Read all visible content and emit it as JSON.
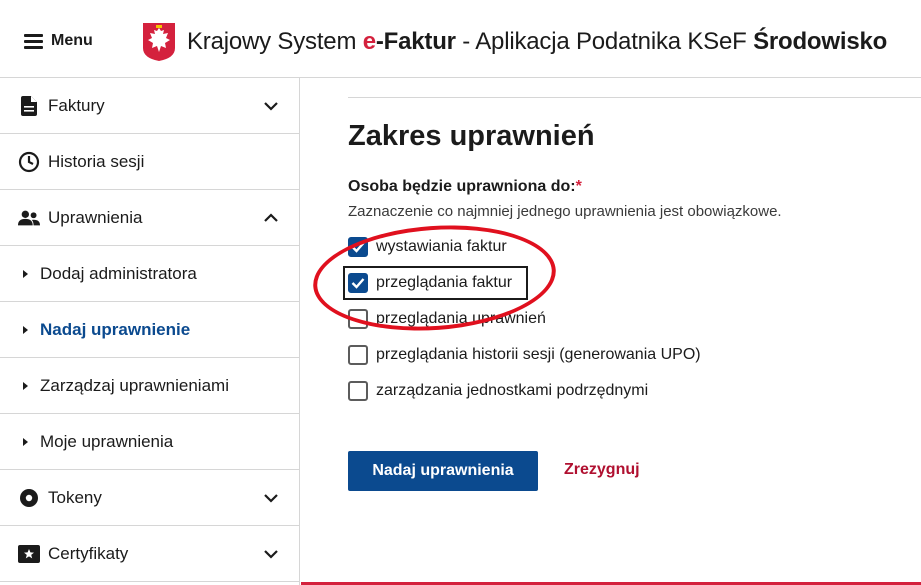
{
  "header": {
    "menu_label": "Menu",
    "title_prefix": "Krajowy System ",
    "title_e": "e",
    "title_faktur": "-Faktur",
    "title_middle": " - Aplikacja Podatnika KSeF ",
    "title_env": "Środowisko"
  },
  "sidebar": {
    "items": [
      {
        "label": "Faktury",
        "icon": "document-icon"
      },
      {
        "label": "Historia sesji",
        "icon": "clock-icon"
      },
      {
        "label": "Uprawnienia",
        "icon": "users-icon"
      },
      {
        "label": "Dodaj administratora"
      },
      {
        "label": "Nadaj uprawnienie"
      },
      {
        "label": "Zarządzaj uprawnieniami"
      },
      {
        "label": "Moje uprawnienia"
      },
      {
        "label": "Tokeny",
        "icon": "token-icon"
      },
      {
        "label": "Certyfikaty",
        "icon": "certificate-icon"
      }
    ]
  },
  "main": {
    "section_title": "Zakres uprawnień",
    "field_label": "Osoba będzie uprawniona do:",
    "required_mark": "*",
    "hint": "Zaznaczenie co najmniej jednego uprawnienia jest obowiązkowe.",
    "options": [
      {
        "label": "wystawiania faktur",
        "checked": true
      },
      {
        "label": "przeglądania faktur",
        "checked": true
      },
      {
        "label": "przeglądania uprawnień",
        "checked": false
      },
      {
        "label": "przeglądania historii sesji (generowania UPO)",
        "checked": false
      },
      {
        "label": "zarządzania jednostkami podrzędnymi",
        "checked": false
      }
    ],
    "submit_label": "Nadaj uprawnienia",
    "cancel_label": "Zrezygnuj"
  },
  "colors": {
    "primary": "#0b4a8f",
    "accent_red": "#d4213d",
    "annotation_red": "#e0101e",
    "cancel_red": "#b01030"
  }
}
